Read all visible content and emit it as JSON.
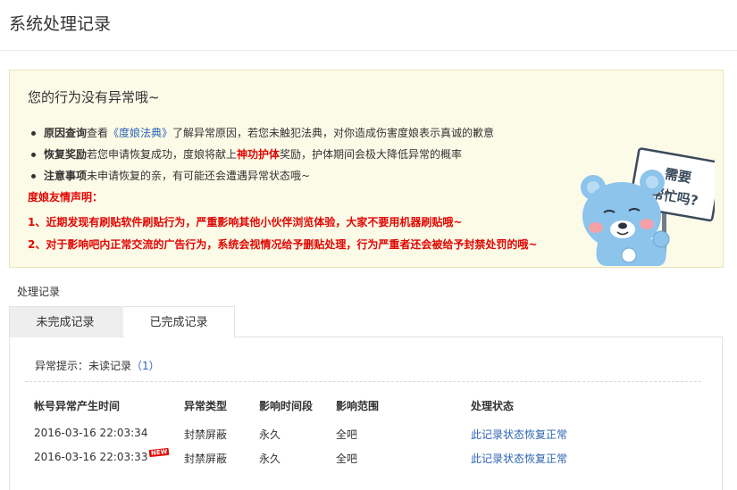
{
  "page": {
    "title": "系统处理记录"
  },
  "notice": {
    "heading": "您的行为没有异常哦~",
    "items": [
      {
        "label": "原因查询",
        "before": " 查看 ",
        "link": "《度娘法典》",
        "after": "了解异常原因，若您未触犯法典，对你造成伤害度娘表示真诚的歉意"
      },
      {
        "label": "恢复奖励",
        "before": "若您申请恢复成功，度娘将献上",
        "highlight": "神功护体",
        "after": "奖励，护体期间会极大降低异常的概率"
      },
      {
        "label": "注意事项",
        "before": "未申请恢复的亲，有可能还会遭遇异常状态哦~"
      }
    ],
    "declaration_title": "度娘友情声明：",
    "declarations": [
      "1、近期发现有刷贴软件刷贴行为，严重影响其他小伙伴浏览体验，大家不要用机器刷贴哦~",
      "2、对于影响吧内正常交流的广告行为，系统会视情况给予删贴处理，行为严重者还会被给予封禁处罚的哦~"
    ],
    "mascot_sign": [
      "需要",
      "帮忙吗?"
    ],
    "colors": {
      "background": "#fcfbe8",
      "warning_red": "#e10602",
      "link_blue": "#2d64b3"
    }
  },
  "records": {
    "section_label": "处理记录",
    "tabs": [
      {
        "label": "未完成记录",
        "active": false
      },
      {
        "label": "已完成记录",
        "active": true
      }
    ],
    "hint_label": "异常提示：未读记录",
    "hint_count": "（1）",
    "columns": [
      "帐号异常产生时间",
      "异常类型",
      "影响时间段",
      "影响范围",
      "处理状态"
    ],
    "rows": [
      {
        "time": "2016-03-16 22:03:34",
        "type": "封禁屏蔽",
        "duration": "永久",
        "scope": "全吧",
        "status": "此记录状态恢复正常",
        "is_new": false
      },
      {
        "time": "2016-03-16 22:03:33",
        "type": "封禁屏蔽",
        "duration": "永久",
        "scope": "全吧",
        "status": "此记录状态恢复正常",
        "is_new": true,
        "badge": "NEW"
      }
    ]
  }
}
